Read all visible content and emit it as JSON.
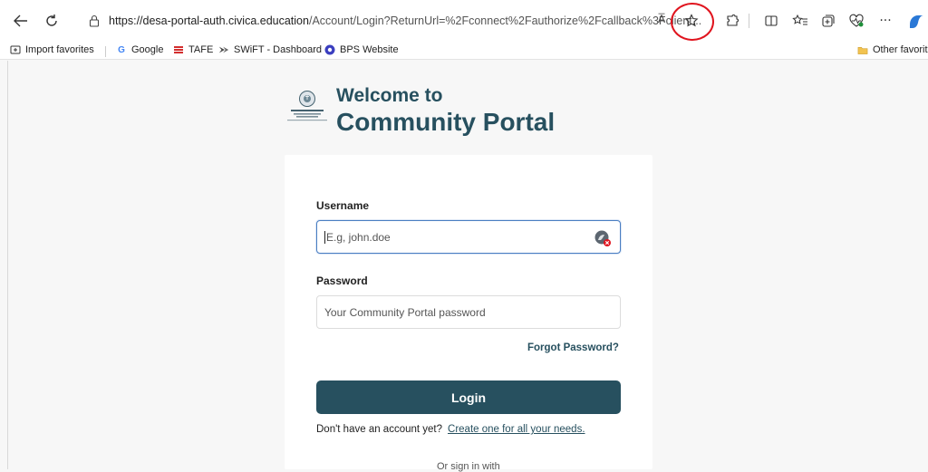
{
  "browser": {
    "url_host": "https://desa-portal-auth.civica.education",
    "url_path": "/Account/Login?ReturnUrl=%2Fconnect%2Fauthorize%2Fcallback%3Fclient...",
    "read_aloud": "A̅",
    "icons": {
      "back": "back-arrow-icon",
      "refresh": "refresh-icon",
      "lock": "lock-icon",
      "favorite": "star-icon",
      "extensions": "extensions-icon",
      "split_screen": "split-screen-icon",
      "favorites": "favorites-icon",
      "collections": "collections-icon",
      "performance": "heartbeat-icon",
      "more": "more-icon",
      "copilot": "copilot-icon"
    },
    "more_label": "···",
    "highlight_color": "#e0141e"
  },
  "favorites_bar": {
    "items": [
      {
        "label": "Import favorites",
        "icon": "import-icon"
      },
      {
        "label": "Google",
        "icon": "google-icon"
      },
      {
        "label": "TAFE",
        "icon": "tafe-icon"
      },
      {
        "label": "SWiFT - Dashboard",
        "icon": "swift-icon"
      },
      {
        "label": "BPS Website",
        "icon": "bps-icon"
      }
    ],
    "other": "Other favorite"
  },
  "page": {
    "welcome": "Welcome to",
    "title": "Community Portal",
    "accent": "#27505f",
    "form": {
      "username_label": "Username",
      "username_placeholder": "E.g, john.doe",
      "password_label": "Password",
      "password_placeholder": "Your Community Portal password",
      "forgot": "Forgot Password?",
      "login": "Login",
      "no_account": "Don't have an account yet?",
      "create": "Create one for all your needs.",
      "signin_with": "Or sign in with"
    }
  }
}
